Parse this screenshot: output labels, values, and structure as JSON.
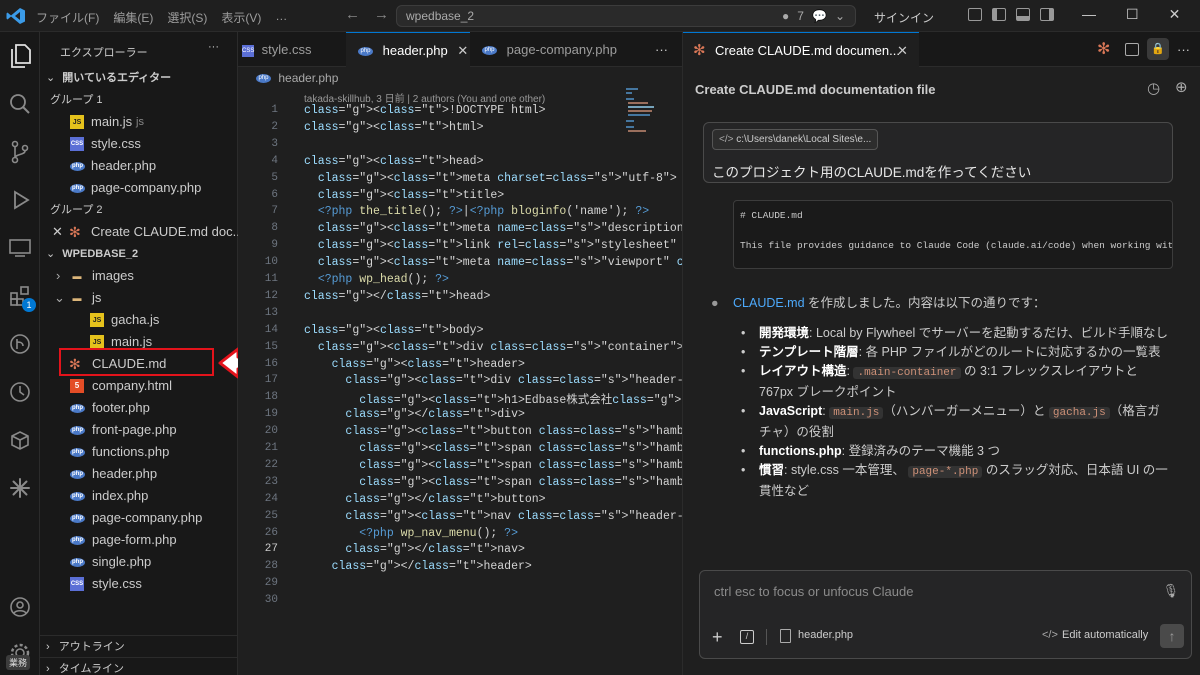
{
  "titlebar": {
    "menus": [
      "ファイル(F)",
      "編集(E)",
      "選択(S)",
      "表示(V)",
      "…"
    ],
    "search_text": "wpedbase_2",
    "notifications_count": "7",
    "signin_label": "サインイン"
  },
  "sidebar": {
    "title": "エクスプローラー",
    "open_editors_label": "開いているエディター",
    "group1_label": "グループ 1",
    "group1_items": [
      {
        "name": "main.js",
        "suffix": "js"
      },
      {
        "name": "style.css"
      },
      {
        "name": "header.php"
      },
      {
        "name": "page-company.php"
      }
    ],
    "group2_label": "グループ 2",
    "group2_item": "Create CLAUDE.md doc...",
    "project_label": "WPEDBASE_2",
    "tree": {
      "images": "images",
      "js": "js",
      "gacha": "gacha.js",
      "mainjs": "main.js",
      "claude": "CLAUDE.md",
      "company_html": "company.html",
      "footer": "footer.php",
      "front_page": "front-page.php",
      "functions": "functions.php",
      "header": "header.php",
      "index": "index.php",
      "page_company": "page-company.php",
      "page_form": "page-form.php",
      "single": "single.php",
      "style": "style.css"
    },
    "outline_label": "アウトライン",
    "timeline_label": "タイムライン",
    "accounts_badge": "業務"
  },
  "editor": {
    "tabs": [
      "style.css",
      "header.php",
      "page-company.php"
    ],
    "breadcrumb": "header.php",
    "blame": "takada-skillhub, 3 日前 | 2 authors (You and one other)",
    "line_numbers": [
      "1",
      "2",
      "3",
      "4",
      "5",
      "6",
      "7",
      "8",
      "9",
      "10",
      "11",
      "12",
      "13",
      "14",
      "15",
      "16",
      "17",
      "18",
      "19",
      "20",
      "21",
      "22",
      "23",
      "24",
      "25",
      "26",
      "27",
      "28",
      "29",
      "30"
    ],
    "code_lines": [
      "<!DOCTYPE html>",
      "<html>",
      "",
      "<head>",
      "  <meta charset=\"utf-8\">",
      "  <title>",
      "  <?php the_title(); ?>|<?php bloginfo('name'); ?>",
      "  <meta name=\"description\" content=\"<?php the_ti",
      "  <link rel=\"stylesheet\" href=\"<?php echo get_te",
      "  <meta name=\"viewport\" content=\"width=device-wi",
      "  <?php wp_head(); ?>",
      "</head>",
      "",
      "<body>",
      "  <div class=\"container\">",
      "    <header>",
      "      <div class=\"header-logo\">",
      "        <h1>Edbase株式会社</h1>",
      "      </div>",
      "      <button class=\"hamburger\" type=\"button\" ar",
      "        <span class=\"hamburger-bar\"></span>",
      "        <span class=\"hamburger-bar\"></span>",
      "        <span class=\"hamburger-bar\"></span>",
      "      </button>",
      "      <nav class=\"header-nav\" id=\"header-nav\">",
      "        <?php wp_nav_menu(); ?>",
      "      </nav>",
      "    </header>",
      "",
      ""
    ]
  },
  "chat": {
    "tab_label": "Create CLAUDE.md documen...",
    "title": "Create CLAUDE.md documentation file",
    "path_chip": "c:\\Users\\danek\\Local Sites\\e...",
    "user_message": "このプロジェクト用のCLAUDE.mdを作ってください",
    "codebox_line1": "# CLAUDE.md",
    "codebox_line2": "This file provides guidance to Claude Code (claude.ai/code) when working with code in this repository.",
    "response_link": "CLAUDE.md",
    "response_text": " を作成しました。内容は以下の通りです：",
    "bullets": [
      {
        "bold": "開発環境",
        "text": ": Local by Flywheel でサーバーを起動するだけ、ビルド手順なし"
      },
      {
        "bold": "テンプレート階層",
        "text": ": 各 PHP ファイルがどのルートに対応するかの一覧表"
      },
      {
        "bold": "レイアウト構造",
        "text": ":",
        "code": ".main-container",
        "text2": " の 3:1 フレックスレイアウトと 767px ブレークポイント"
      },
      {
        "bold": "JavaScript",
        "text": ":",
        "code": "main.js",
        "text2": "（ハンバーガーメニュー）と",
        "code2": "gacha.js",
        "text3": "（格言ガチャ）の役割"
      },
      {
        "bold": "functions.php",
        "text": ": 登録済みのテーマ機能 3 つ"
      },
      {
        "bold": "慣習",
        "text": ": style.css 一本管理、",
        "code": "page-*.php",
        "text2": " のスラッグ対応、日本語 UI の一貫性など"
      }
    ],
    "input_placeholder": "ctrl esc to focus or unfocus Claude",
    "attached_file": "header.php",
    "mode_label": "Edit automatically"
  }
}
